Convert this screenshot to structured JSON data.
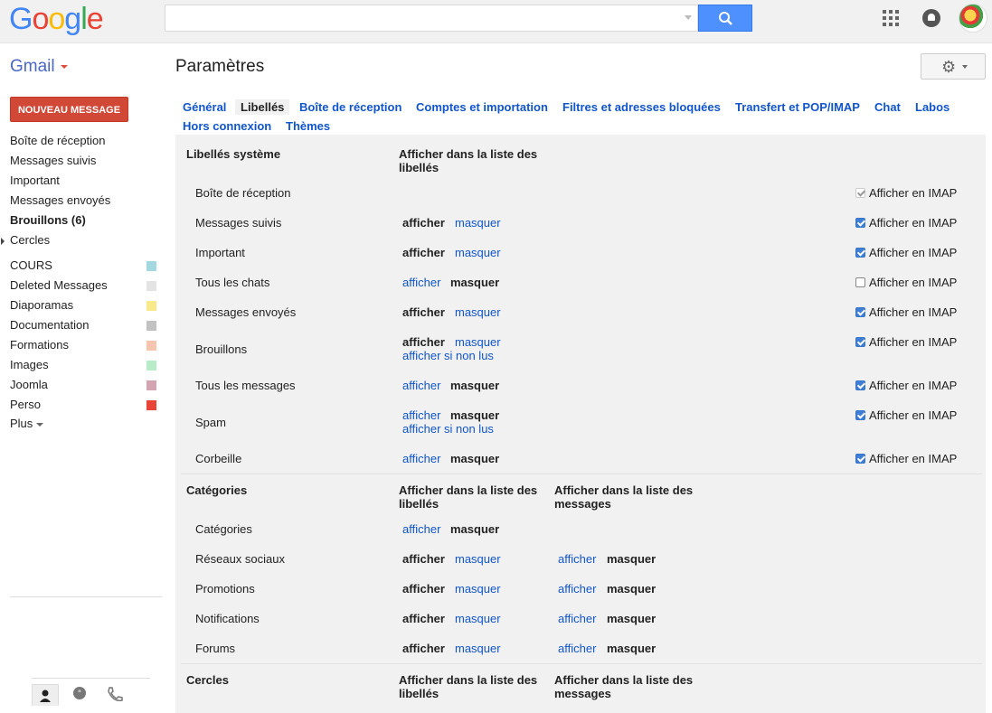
{
  "logo": {
    "letters": [
      {
        "t": "G",
        "c": "#4285f4"
      },
      {
        "t": "o",
        "c": "#ea4335"
      },
      {
        "t": "o",
        "c": "#fbbc05"
      },
      {
        "t": "g",
        "c": "#4285f4"
      },
      {
        "t": "l",
        "c": "#34a853"
      },
      {
        "t": "e",
        "c": "#ea4335"
      }
    ]
  },
  "search": {
    "value": "",
    "placeholder": ""
  },
  "app": {
    "name": "Gmail",
    "page_title": "Paramètres"
  },
  "compose": {
    "label": "NOUVEAU MESSAGE"
  },
  "sidebar": {
    "items": [
      {
        "label": "Boîte de réception",
        "bold": false
      },
      {
        "label": "Messages suivis",
        "bold": false
      },
      {
        "label": "Important",
        "bold": false
      },
      {
        "label": "Messages envoyés",
        "bold": false
      },
      {
        "label": "Brouillons (6)",
        "bold": true
      },
      {
        "label": "Cercles",
        "bold": false
      }
    ],
    "labels": [
      {
        "label": "COURS",
        "color": "#a4d8e0"
      },
      {
        "label": "Deleted Messages",
        "color": "#e3e3e3"
      },
      {
        "label": "Diaporamas",
        "color": "#f8e98a"
      },
      {
        "label": "Documentation",
        "color": "#c2c2c2"
      },
      {
        "label": "Formations",
        "color": "#f6c5b0"
      },
      {
        "label": "Images",
        "color": "#b8ebc8"
      },
      {
        "label": "Joomla",
        "color": "#d3a5b3"
      },
      {
        "label": "Perso",
        "color": "#e84437"
      }
    ],
    "more": "Plus"
  },
  "tabs": [
    {
      "label": "Général",
      "active": false
    },
    {
      "label": "Libellés",
      "active": true
    },
    {
      "label": "Boîte de réception",
      "active": false
    },
    {
      "label": "Comptes et importation",
      "active": false
    },
    {
      "label": "Filtres et adresses bloquées",
      "active": false
    },
    {
      "label": "Transfert et POP/IMAP",
      "active": false
    },
    {
      "label": "Chat",
      "active": false
    },
    {
      "label": "Labos",
      "active": false
    },
    {
      "label": "Hors connexion",
      "active": false
    },
    {
      "label": "Thèmes",
      "active": false
    }
  ],
  "system": {
    "title": "Libellés système",
    "col1": "Afficher dans la liste des libellés",
    "rows": [
      {
        "label": "Boîte de réception",
        "show": null,
        "unread": false,
        "imap": "disabled"
      },
      {
        "label": "Messages suivis",
        "show": "afficher",
        "unread": false,
        "imap": "on"
      },
      {
        "label": "Important",
        "show": "afficher",
        "unread": false,
        "imap": "on"
      },
      {
        "label": "Tous les chats",
        "show": "masquer",
        "unread": false,
        "imap": "off"
      },
      {
        "label": "Messages envoyés",
        "show": "afficher",
        "unread": false,
        "imap": "on"
      },
      {
        "label": "Brouillons",
        "show": "afficher",
        "unread": true,
        "imap": "on"
      },
      {
        "label": "Tous les messages",
        "show": "masquer",
        "unread": false,
        "imap": "on"
      },
      {
        "label": "Spam",
        "show": "masquer",
        "unread": true,
        "imap": "on"
      },
      {
        "label": "Corbeille",
        "show": "masquer",
        "unread": false,
        "imap": "on"
      }
    ],
    "imap_label": "Afficher en IMAP",
    "show_label": "afficher",
    "hide_label": "masquer",
    "unread_label": "afficher si non lus"
  },
  "categories": {
    "title": "Catégories",
    "col1": "Afficher dans la liste des libellés",
    "col2": "Afficher dans la liste des messages",
    "rows": [
      {
        "label": "Catégories",
        "show1": "masquer",
        "show2": null
      },
      {
        "label": "Réseaux sociaux",
        "show1": "afficher",
        "show2": "masquer"
      },
      {
        "label": "Promotions",
        "show1": "afficher",
        "show2": "masquer"
      },
      {
        "label": "Notifications",
        "show1": "afficher",
        "show2": "masquer"
      },
      {
        "label": "Forums",
        "show1": "afficher",
        "show2": "masquer"
      }
    ]
  },
  "circles": {
    "title": "Cercles",
    "col1": "Afficher dans la liste des libellés",
    "col2": "Afficher dans la liste des messages"
  }
}
